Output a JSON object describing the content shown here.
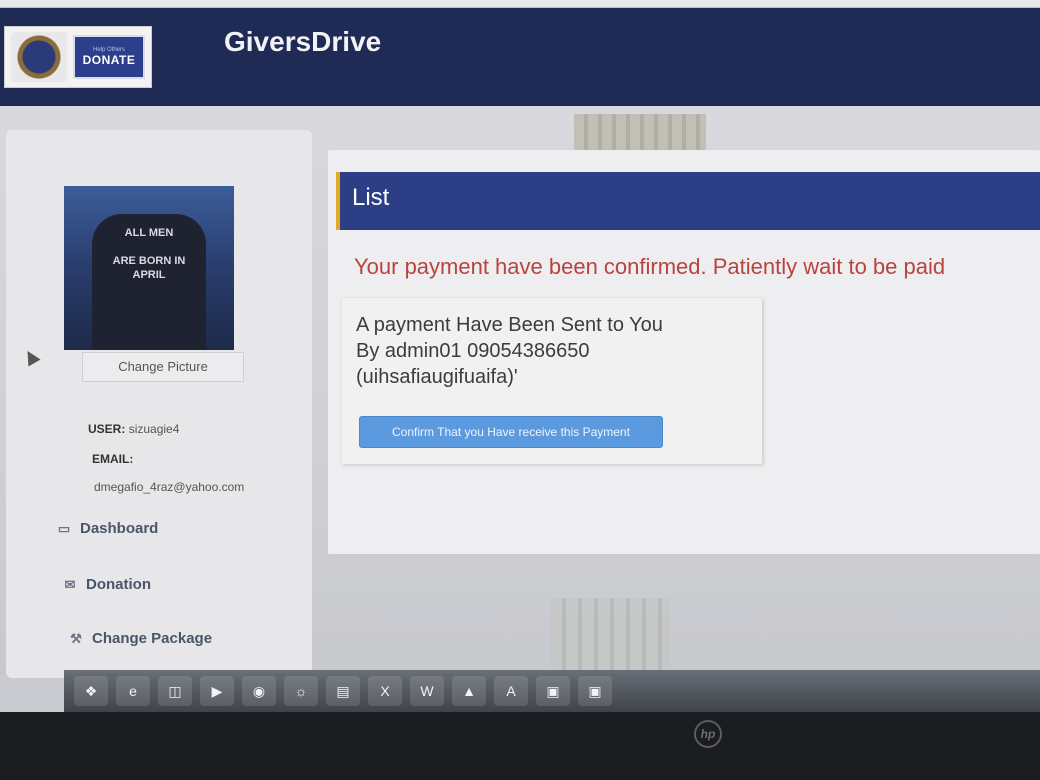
{
  "header": {
    "logo_donate_small": "Help Others",
    "logo_donate_label": "DONATE",
    "app_title": "GiversDrive"
  },
  "sidebar": {
    "change_picture": "Change Picture",
    "avatar_shirt_text": "ALL MEN ARE BORN IN APRIL",
    "user_label": "USER:",
    "user_value": "sizuagie4",
    "email_label": "EMAIL:",
    "email_value": "dmegafio_4raz@yahoo.com",
    "nav": [
      {
        "label": "Dashboard",
        "icon": "monitor-icon"
      },
      {
        "label": "Donation",
        "icon": "envelope-icon"
      },
      {
        "label": "Change Package",
        "icon": "wrench-icon"
      }
    ]
  },
  "main": {
    "panel_title": "List",
    "alert": "Your payment have been confirmed. Patiently wait to be paid",
    "payment": {
      "line1": "A payment Have Been Sent to You",
      "line2": "By admin01 09054386650",
      "line3": "(uihsafiaugifuaifa)'",
      "confirm_button": "Confirm That you Have receive this Payment"
    }
  },
  "taskbar": {
    "icons": [
      "windows-start-icon",
      "ie-icon",
      "explorer-icon",
      "media-icon",
      "chrome-icon",
      "firefox-icon",
      "folder-icon",
      "excel-icon",
      "word-icon",
      "vlc-icon",
      "acrobat-icon",
      "app-icon",
      "app-icon-2"
    ]
  },
  "colors": {
    "header_bg": "#1f2a55",
    "panel_head_bg": "#2c3f86",
    "alert_text": "#b8433f",
    "button_bg": "#5c9ae0"
  }
}
